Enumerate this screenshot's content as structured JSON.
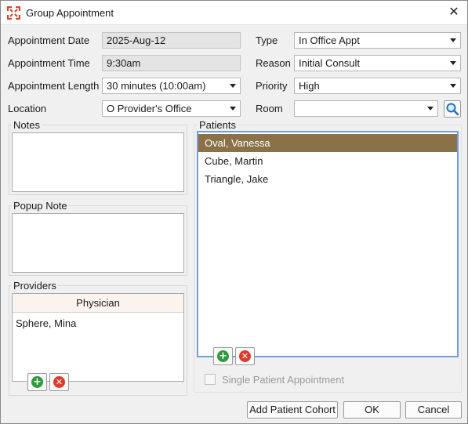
{
  "window": {
    "title": "Group Appointment",
    "close_glyph": "✕"
  },
  "form": {
    "appointment_date": {
      "label": "Appointment Date",
      "value": "2025-Aug-12"
    },
    "appointment_time": {
      "label": "Appointment Time",
      "value": "9:30am"
    },
    "appointment_length": {
      "label": "Appointment Length",
      "value": "30 minutes (10:00am)"
    },
    "location": {
      "label": "Location",
      "value": "O Provider's Office"
    },
    "type": {
      "label": "Type",
      "value": "In Office Appt"
    },
    "reason": {
      "label": "Reason",
      "value": "Initial Consult"
    },
    "priority": {
      "label": "Priority",
      "value": "High"
    },
    "room": {
      "label": "Room",
      "value": ""
    }
  },
  "notes": {
    "label": "Notes"
  },
  "popup_note": {
    "label": "Popup Note"
  },
  "providers": {
    "label": "Providers",
    "column_header": "Physician",
    "rows": [
      "Sphere, Mina"
    ]
  },
  "patients": {
    "label": "Patients",
    "rows": [
      "Oval, Vanessa",
      "Cube, Martin",
      "Triangle, Jake"
    ],
    "selected_index": 0
  },
  "single_patient": {
    "label": "Single Patient Appointment",
    "checked": false,
    "enabled": false
  },
  "buttons": {
    "add_patient_cohort": "Add Patient Cohort",
    "ok": "OK",
    "cancel": "Cancel"
  },
  "colors": {
    "selected_row": "#8b7148",
    "list_focus_border": "#6f9fd8",
    "add_icon": "#2f9a3a",
    "remove_icon": "#e03a2c",
    "app_icon": "#d9432f"
  },
  "icons": {
    "app": "app-logo-icon",
    "close": "close-icon",
    "dropdown": "chevron-down-icon",
    "search": "search-icon",
    "add": "add-icon",
    "remove": "remove-icon"
  }
}
